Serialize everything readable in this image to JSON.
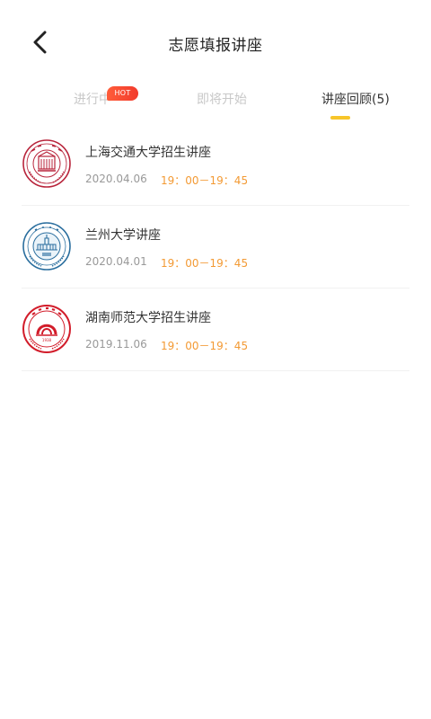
{
  "header": {
    "title": "志愿填报讲座",
    "back_icon": "chevron-left-icon"
  },
  "tabs": [
    {
      "label": "进行中",
      "active": false
    },
    {
      "label": "即将开始",
      "active": false
    },
    {
      "label": "讲座回顾(5)",
      "active": true
    }
  ],
  "hot_badge": "HOT",
  "colors": {
    "accent": "#f7c52a",
    "time_orange": "#f39a34",
    "hot_red": "#f23b2c",
    "sjtu_red": "#b8243b",
    "lzu_blue": "#2a6e9e",
    "hunnu_red": "#d21c2a"
  },
  "lectures": [
    {
      "title": "上海交通大学招生讲座",
      "date": "2020.04.06",
      "time": "19：00－19：45",
      "logo": "sjtu-logo"
    },
    {
      "title": "兰州大学讲座",
      "date": "2020.04.01",
      "time": "19：00－19：45",
      "logo": "lzu-logo"
    },
    {
      "title": "湖南师范大学招生讲座",
      "date": "2019.11.06",
      "time": "19：00－19：45",
      "logo": "hunnu-logo"
    }
  ]
}
